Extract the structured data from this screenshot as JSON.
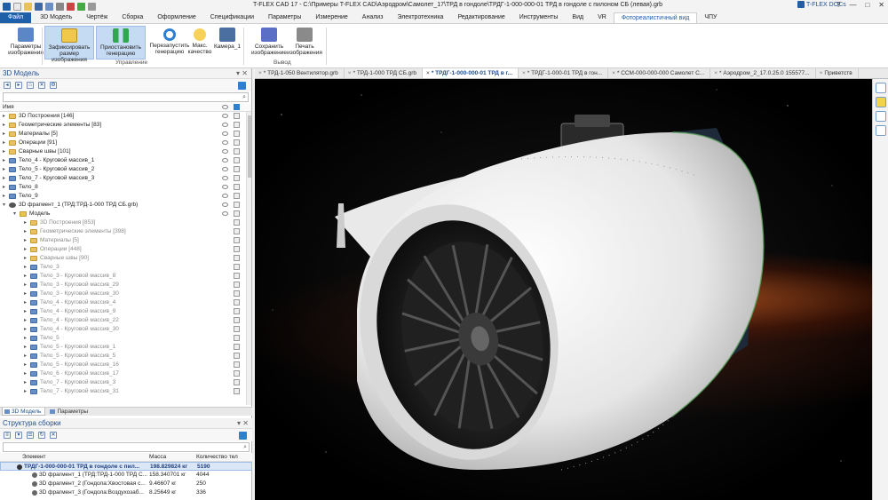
{
  "window": {
    "title": "T-FLEX CAD 17 - C:\\Примеры T-FLEX CAD\\Аэродром\\Самолет_17\\ТРД в гондоле\\ТРДГ-1-000-000-01 ТРД в гондоле с пилоном СБ (левая).grb",
    "docs_label": "T-FLEX DOCs"
  },
  "ribbon": {
    "file_tab": "Файл",
    "tabs": [
      "3D Модель",
      "Чертёж",
      "Сборка",
      "Оформление",
      "Спецификации",
      "Параметры",
      "Измерение",
      "Анализ",
      "Электротехника",
      "Редактирование",
      "Инструменты",
      "Вид",
      "VR",
      "Фотореалистичный вид",
      "ЧПУ"
    ],
    "active_tab": "Фотореалистичный вид",
    "buttons": [
      {
        "label": "Параметры изображения"
      },
      {
        "label": "Зафиксировать размер изображения"
      },
      {
        "label": "Приостановить генерацию"
      },
      {
        "label": "Перезапустить генерацию"
      },
      {
        "label": "Макс. качество"
      },
      {
        "label": "Камера_1"
      },
      {
        "label": "Сохранить изображение"
      },
      {
        "label": "Печать изображения"
      }
    ],
    "groups": {
      "control": "Управление",
      "output": "Вывод"
    }
  },
  "model_panel": {
    "title": "3D Модель",
    "column_name": "Имя",
    "tree": [
      {
        "label": "3D Построения [146]",
        "type": "folder",
        "level": 0
      },
      {
        "label": "Геометрические элементы [83]",
        "type": "folder",
        "level": 0
      },
      {
        "label": "Материалы [5]",
        "type": "folder",
        "level": 0
      },
      {
        "label": "Операции [91]",
        "type": "folder",
        "level": 0
      },
      {
        "label": "Сварные швы [101]",
        "type": "folder",
        "level": 0
      },
      {
        "label": "Тело_4 - Круговой массив_1",
        "type": "body",
        "level": 0
      },
      {
        "label": "Тело_5 - Круговой массив_2",
        "type": "body",
        "level": 0
      },
      {
        "label": "Тело_7 - Круговой массив_3",
        "type": "body",
        "level": 0
      },
      {
        "label": "Тело_8",
        "type": "body",
        "level": 0
      },
      {
        "label": "Тело_9",
        "type": "body",
        "level": 0
      },
      {
        "label": "3D фрагмент_1 (ТРД:ТРД-1-000 ТРД СБ.grb)",
        "type": "frag",
        "level": 0
      },
      {
        "label": "Модель",
        "type": "folder",
        "level": 1
      },
      {
        "label": "3D Построения [853]",
        "type": "folder",
        "level": 2,
        "dim": true
      },
      {
        "label": "Геометрические элементы [398]",
        "type": "folder",
        "level": 2,
        "dim": true
      },
      {
        "label": "Материалы [5]",
        "type": "folder",
        "level": 2,
        "dim": true
      },
      {
        "label": "Операции [448]",
        "type": "folder",
        "level": 2,
        "dim": true
      },
      {
        "label": "Сварные швы [90]",
        "type": "folder",
        "level": 2,
        "dim": true
      },
      {
        "label": "Тело_3",
        "type": "body",
        "level": 2,
        "dim": true
      },
      {
        "label": "Тело_3 - Круговой массив_8",
        "type": "body",
        "level": 2,
        "dim": true
      },
      {
        "label": "Тело_3 - Круговой массив_29",
        "type": "body",
        "level": 2,
        "dim": true
      },
      {
        "label": "Тело_3 - Круговой массив_30",
        "type": "body",
        "level": 2,
        "dim": true
      },
      {
        "label": "Тело_4 - Круговой массив_4",
        "type": "body",
        "level": 2,
        "dim": true
      },
      {
        "label": "Тело_4 - Круговой массив_9",
        "type": "body",
        "level": 2,
        "dim": true
      },
      {
        "label": "Тело_4 - Круговой массив_22",
        "type": "body",
        "level": 2,
        "dim": true
      },
      {
        "label": "Тело_4 - Круговой массив_30",
        "type": "body",
        "level": 2,
        "dim": true
      },
      {
        "label": "Тело_5",
        "type": "body",
        "level": 2,
        "dim": true
      },
      {
        "label": "Тело_5 - Круговой массив_1",
        "type": "body",
        "level": 2,
        "dim": true
      },
      {
        "label": "Тело_5 - Круговой массив_5",
        "type": "body",
        "level": 2,
        "dim": true
      },
      {
        "label": "Тело_5 - Круговой массив_16",
        "type": "body",
        "level": 2,
        "dim": true
      },
      {
        "label": "Тело_6 - Круговой массив_17",
        "type": "body",
        "level": 2,
        "dim": true
      },
      {
        "label": "Тело_7 - Круговой массив_3",
        "type": "body",
        "level": 2,
        "dim": true
      },
      {
        "label": "Тело_7 - Круговой массив_31",
        "type": "body",
        "level": 2,
        "dim": true
      }
    ],
    "tabs": [
      "3D Модель",
      "Параметры"
    ]
  },
  "assembly_panel": {
    "title": "Структура сборки",
    "columns": [
      "Элемент",
      "Масса",
      "Количество тел"
    ],
    "rows": [
      {
        "name": "ТРДГ-1-000-000-01 ТРД в гондоле с пил...",
        "mass": "198.829824 кг",
        "count": "5190"
      },
      {
        "name": "3D фрагмент_1 (ТРД:ТРД-1-000 ТРД С...",
        "mass": "158.340701 кг",
        "count": "4044"
      },
      {
        "name": "3D фрагмент_2 (Гондола:Хвостовая с...",
        "mass": "9.46607 кг",
        "count": "250"
      },
      {
        "name": "3D фрагмент_3 (Гондола:Воздухозаб...",
        "mass": "8.25649 кг",
        "count": "336"
      }
    ]
  },
  "doc_tabs": [
    {
      "label": "* ТРД-1-050 Вентилятор.grb",
      "active": false
    },
    {
      "label": "* ТРД-1-000 ТРД СБ.grb",
      "active": false
    },
    {
      "label": "* ТРДГ-1-000-000-01 ТРД в г...",
      "active": true
    },
    {
      "label": "* ТРДГ-1-000-01 ТРД в гон...",
      "active": false
    },
    {
      "label": "* ССМ-000-000-000 Самолет С...",
      "active": false
    },
    {
      "label": "* Аэродром_2_17.0.25.0 155577...",
      "active": false
    },
    {
      "label": "Приветств",
      "active": false
    }
  ]
}
